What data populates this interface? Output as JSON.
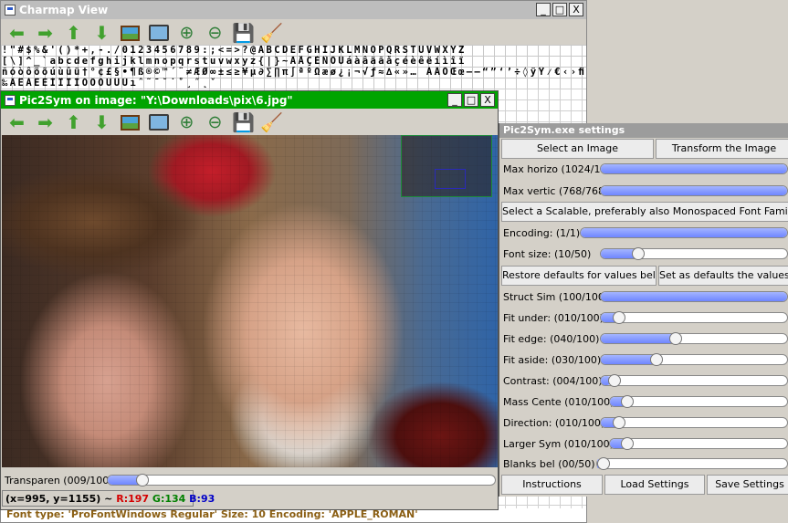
{
  "charmap": {
    "title": "Charmap View",
    "window_buttons": [
      "_",
      "□",
      "X"
    ],
    "glyph_rows": [
      "!\"#$%&'()*+,-./0123456789:;<=>?@ABCDEFGHIJKLMNOPQRSTUVWXYZ",
      "[\\]^_`abcdefghijklmnopqrstuvwxyz{|}~ÄÅÇÉÑÖÜáàâäãåçéèêëíìîï",
      "ñóòôöõúùûü†°¢£§•¶ß®©™´¨≠ÆØ∞±≤≥¥µ∂∑∏π∫ªºΩæø¿¡¬√ƒ≈∆«»… ÀÃÕŒœ–—“”‘’÷◊ÿŸ⁄€‹›ﬁﬂ‡·‚„",
      "‰ÂÊÁËÈÍÎÏÌÓÔÒÚÛÙıˆ˜¯˘˙˚¸˝˛ˇ"
    ],
    "font_status": "Font type: 'ProFontWindows Regular' Size: 10 Encoding: 'APPLE_ROMAN'"
  },
  "pic2sym": {
    "title": "Pic2Sym on image: \"Y:\\Downloads\\pix\\6.jpg\"",
    "window_buttons": [
      "_",
      "□",
      "X"
    ],
    "transparency": {
      "label": "Transparen (009/100)",
      "value": 9,
      "max": 100
    },
    "status": {
      "coords": "(x=995, y=1155) ~",
      "r": "R:197",
      "g": "G:134",
      "b": "B:93"
    }
  },
  "toolbar_icons": [
    "arrow-left-icon",
    "arrow-right-icon",
    "arrow-up-icon",
    "arrow-down-icon",
    "picture-icon",
    "camera-icon",
    "zoom-in-icon",
    "zoom-out-icon",
    "save-icon",
    "broom-icon"
  ],
  "settings": {
    "title": "Pic2Sym.exe settings",
    "select_image": "Select an Image",
    "transform_image": "Transform the Image",
    "select_font": "Select a Scalable, preferably also Monospaced Font Family",
    "restore_defaults": "Restore defaults for values below",
    "set_defaults": "Set as defaults the values below",
    "instructions": "Instructions",
    "load_settings": "Load Settings",
    "save_settings": "Save Settings",
    "sliders": [
      {
        "key": "max_horiz",
        "label": "Max horizo (1024/1024)",
        "value": 1024,
        "max": 1024
      },
      {
        "key": "max_vert",
        "label": "Max vertic (768/768)",
        "value": 768,
        "max": 768
      },
      {
        "key": "encoding",
        "label": "Encoding:  (1/1)",
        "value": 1,
        "max": 1
      },
      {
        "key": "font_size",
        "label": "Font size: (10/50)",
        "value": 10,
        "max": 50
      },
      {
        "key": "struct_sim",
        "label": "Struct Sim (100/100)",
        "value": 100,
        "max": 100
      },
      {
        "key": "fit_under",
        "label": "Fit under: (010/100)",
        "value": 10,
        "max": 100
      },
      {
        "key": "fit_edge",
        "label": "Fit edge:  (040/100)",
        "value": 40,
        "max": 100
      },
      {
        "key": "fit_aside",
        "label": "Fit aside: (030/100)",
        "value": 30,
        "max": 100
      },
      {
        "key": "contrast",
        "label": "Contrast:  (004/100)",
        "value": 4,
        "max": 100
      },
      {
        "key": "mass_center",
        "label": "Mass Cente (010/100)",
        "value": 10,
        "max": 100
      },
      {
        "key": "direction",
        "label": "Direction: (010/100)",
        "value": 10,
        "max": 100
      },
      {
        "key": "larger_sym",
        "label": "Larger Sym (010/100)",
        "value": 10,
        "max": 100
      },
      {
        "key": "blanks_below",
        "label": "Blanks bel (00/50)",
        "value": 0,
        "max": 50
      }
    ]
  }
}
